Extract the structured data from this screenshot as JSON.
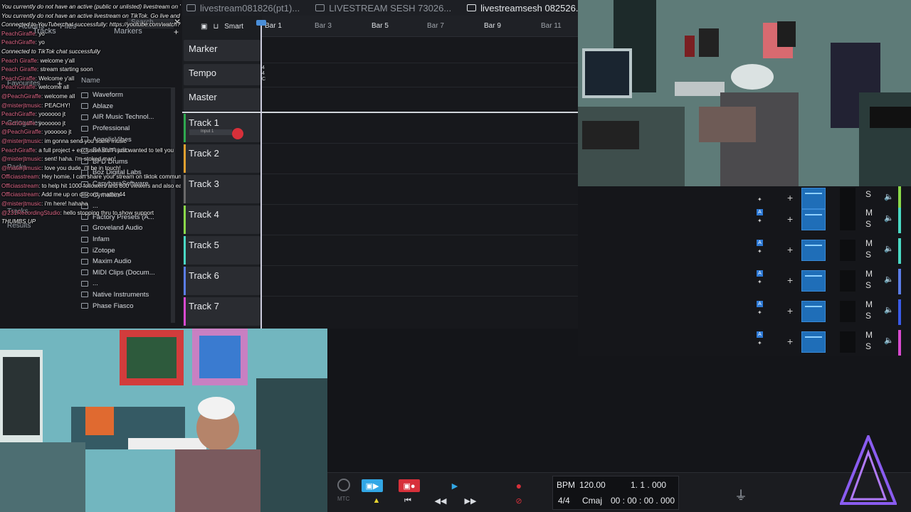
{
  "tabs": [
    {
      "label": "livestream081826(pt1)...",
      "active": false
    },
    {
      "label": "LIVESTREAM SESH 73026...",
      "active": false
    },
    {
      "label": "livestreamsesh 082526...",
      "active": true
    }
  ],
  "browser": {
    "header": [
      "Actions",
      "Files",
      "Tracks",
      "Markers"
    ],
    "search_placeholder": "Search",
    "name_column": "Name",
    "side_labels": [
      "Favourites",
      "Categories",
      "Packs",
      "Tracks",
      "Results"
    ],
    "folders": [
      "Waveform",
      "Ablaze",
      "AIR Music Technol...",
      "Professional",
      "AngelicVibes",
      "BABY Audio",
      "BFD Drums",
      "Boz Digital Labs",
      "CapybaraSoftware",
      "Cymatics",
      "...",
      "Factory Presets (A...",
      "Groveland Audio",
      "Infam",
      "iZotope",
      "Maxim Audio",
      "MIDI Clips (Docum...",
      "...",
      "Native Instruments",
      "Phase Fiasco"
    ]
  },
  "chat": [
    {
      "user": "",
      "msg": "You currently do not have an active (public or unlisted) livestream on YouTube. Go live and we'll connect to your chat in a few minutes automatically. Click here to go to your YouTube live dashboard",
      "sys": true
    },
    {
      "user": "",
      "msg": "You currently do not have an active livestream on TikTok. Go live and we'll connect to your chat in a few minutes automatically.",
      "sys": true
    },
    {
      "user": "",
      "msg": "Connected to YouTube chat successfully: https://youtube.com/watch?",
      "sys": true
    },
    {
      "user": "PeachGiraffe",
      "msg": "yo",
      "sys": false
    },
    {
      "user": "PeachGiraffe",
      "msg": "yo",
      "sys": false
    },
    {
      "user": "",
      "msg": "Connected to TikTok chat successfully",
      "sys": true
    },
    {
      "user": "Peach Giraffe",
      "msg": "welcome y'all",
      "sys": false
    },
    {
      "user": "Peach Giraffe",
      "msg": "stream starting soon",
      "sys": false
    },
    {
      "user": "PeachGiraffe",
      "msg": "Welcome y'all",
      "sys": false
    },
    {
      "user": "PeachGiraffe",
      "msg": "welcome all",
      "sys": false
    },
    {
      "user": "@PeachGiraffe",
      "msg": "welcome all",
      "sys": false
    },
    {
      "user": "@misterjtmusic",
      "msg": "PEACHY!",
      "sys": false
    },
    {
      "user": "PeachGiraffe",
      "msg": "yoooooo jt",
      "sys": false
    },
    {
      "user": "PeachGiraffe",
      "msg": "yoooooo jt",
      "sys": false
    },
    {
      "user": "@PeachGiraffe",
      "msg": "yoooooo jt",
      "sys": false
    },
    {
      "user": "@misterjtmusic",
      "msg": "im gonna send you some music",
      "sys": false
    },
    {
      "user": "PeachGiraffe",
      "msg": "a full project + exclusive stuff i just wanted to tell you",
      "sys": false
    },
    {
      "user": "@misterjtmusic",
      "msg": "sent! haha. i'm stoked man!",
      "sys": false
    },
    {
      "user": "@misterjtmusic",
      "msg": "love you dude, i'll be in touch!",
      "sys": false
    },
    {
      "user": "Officiasstream",
      "msg": "Hey homie, I can share your stream on tiktok community.",
      "sys": false
    },
    {
      "user": "Officiasstream",
      "msg": "to help hit 1000 followers and 800 viewers and also earn $1000 per stream",
      "sys": false
    },
    {
      "user": "Officiasstream",
      "msg": "Add me up on discord: mathin44",
      "sys": false
    },
    {
      "user": "@misterjtmusic",
      "msg": "i'm here! hahaha",
      "sys": false
    },
    {
      "user": "@231RecordingStudio",
      "msg": "hello stopping thru to show support",
      "sys": false
    },
    {
      "user": "",
      "msg": "THUMBS UP",
      "sys": true
    }
  ],
  "toolbar": {
    "smart_label": "Smart"
  },
  "ruler": {
    "bars": [
      "Bar 1",
      "Bar 3",
      "Bar 5",
      "Bar 7",
      "Bar 9",
      "Bar 11"
    ]
  },
  "tracks": {
    "marker": "Marker",
    "tempo": "Tempo",
    "master": "Master",
    "list": [
      "Track 1",
      "Track 2",
      "Track 3",
      "Track 4",
      "Track 5",
      "Track 6",
      "Track 7"
    ],
    "input_label": "Input 1",
    "tempo_marks": "4\n4\nC",
    "colors": [
      "#2fa84f",
      "#e0a030",
      "#6a6a6a",
      "#8bd94a",
      "#4ad9c4",
      "#5b7de8",
      "#d94ad0"
    ]
  },
  "mixer": {
    "rows": 5,
    "m_label": "M",
    "s_label": "S",
    "a_label": "A"
  },
  "transport": {
    "bpm_label": "BPM",
    "bpm": "120.00",
    "position": "1. 1 . 000",
    "time_sig": "4/4",
    "key": "Cmaj",
    "time": "00 : 00 : 00 . 000",
    "mtc": "MTC"
  }
}
